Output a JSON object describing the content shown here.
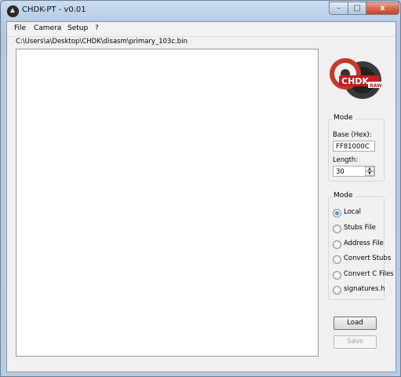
{
  "window": {
    "title": "CHDK-PT - v0.01",
    "controls": {
      "minimize": "–",
      "maximize": "□",
      "close": "x"
    }
  },
  "menu": [
    "File",
    "Camera",
    "Setup",
    "?"
  ],
  "file_path": "C:\\Users\\a\\Desktop\\CHDK\\disasm\\primary_103c.bin",
  "logo": {
    "text": "CHDK",
    "badge": "RAW"
  },
  "mode_settings": {
    "title": "Mode",
    "base_label": "Base (Hex):",
    "base_value": "FF81000C",
    "length_label": "Length:",
    "length_value": "30"
  },
  "mode_options": {
    "title": "Mode",
    "options": [
      {
        "label": "Local",
        "selected": true
      },
      {
        "label": "Stubs File",
        "selected": false
      },
      {
        "label": "Address File",
        "selected": false
      },
      {
        "label": "Convert Stubs",
        "selected": false
      },
      {
        "label": "Convert C Files",
        "selected": false
      },
      {
        "label": "signatures.h",
        "selected": false
      }
    ]
  },
  "buttons": {
    "load": "Load",
    "save": "Save"
  }
}
